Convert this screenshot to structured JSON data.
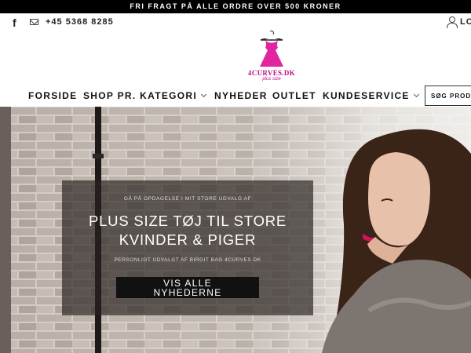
{
  "announcement": "FRI FRAGT PÅ ALLE ORDRE OVER 500 KRONER",
  "topbar": {
    "facebook_glyph": "f",
    "phone": "+45 5368 8285",
    "login_label": "LO",
    "icons": [
      "facebook-icon",
      "mail-icon",
      "user-icon"
    ]
  },
  "logo": {
    "brand": "4CURVES.DK",
    "sub": "plus size",
    "accent": "#e0259f"
  },
  "nav": {
    "items": [
      {
        "label": "FORSIDE",
        "has_dropdown": false
      },
      {
        "label": "SHOP PR. KATEGORI",
        "has_dropdown": true
      },
      {
        "label": "NYHEDER",
        "has_dropdown": false
      },
      {
        "label": "OUTLET",
        "has_dropdown": false
      },
      {
        "label": "KUNDESERVICE",
        "has_dropdown": true
      }
    ],
    "search_label": "SØG PRODUKTER"
  },
  "hero": {
    "kicker": "GÅ PÅ OPDAGELSE I MIT STORE UDVALG AF",
    "headline_line1": "PLUS SIZE TØJ TIL STORE",
    "headline_line2": "KVINDER & PIGER",
    "caption": "PERSONLIGT UDVALGT AF BIRGIT BAG 4CURVES.DK",
    "cta_line1": "VIS ALLE",
    "cta_line2": "NYHEDERNE"
  },
  "colors": {
    "announcement_bg": "#000000",
    "logo_pink": "#e0259f",
    "panel_bg": "#2b2422"
  }
}
